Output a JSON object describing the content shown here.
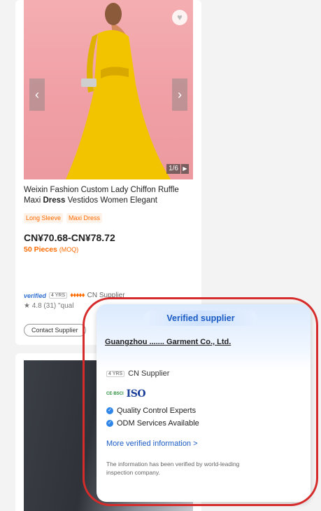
{
  "product": {
    "title_parts": [
      {
        "text": "Weixin Fashion Custom Lady Chiffon Ruffle Maxi ",
        "bold": false
      },
      {
        "text": "Dress",
        "bold": true
      },
      {
        "text": " Vestidos Women Elegant",
        "bold": false
      }
    ],
    "tags": [
      "Long Sleeve",
      "Maxi Dress"
    ],
    "price": "CN¥70.68-CN¥78.72",
    "moq_value": "50 Pieces",
    "moq_unit": "(MOQ)",
    "image_counter": "1/6",
    "supplier": {
      "verified_label": "verified",
      "years": "4 YRS",
      "country_type": "CN Supplier",
      "rating": "4.8 (31)",
      "review_snippet": "\"qual"
    },
    "contact_label": "Contact Supplier"
  },
  "popup": {
    "badge": "Verified supplier",
    "company": "Guangzhou ....... Garment Co., Ltd.",
    "years": "4 YRS",
    "supplier_type": "CN Supplier",
    "certs": {
      "small": "CE·BSCI",
      "iso": "ISO"
    },
    "features": [
      "Quality Control Experts",
      "ODM Services Available"
    ],
    "link": "More verified information >",
    "note": "The information has been verified by world-leading inspection company."
  },
  "icons": {
    "favorite": "heart-icon",
    "prev": "chevron-left-icon",
    "next": "chevron-right-icon",
    "video": "play-icon",
    "rating": "star-icon",
    "check": "check-circle-icon"
  },
  "colors": {
    "accent_orange": "#ff6a00",
    "verified_blue": "#1a5bc4",
    "highlight_red": "#d62b2b"
  }
}
